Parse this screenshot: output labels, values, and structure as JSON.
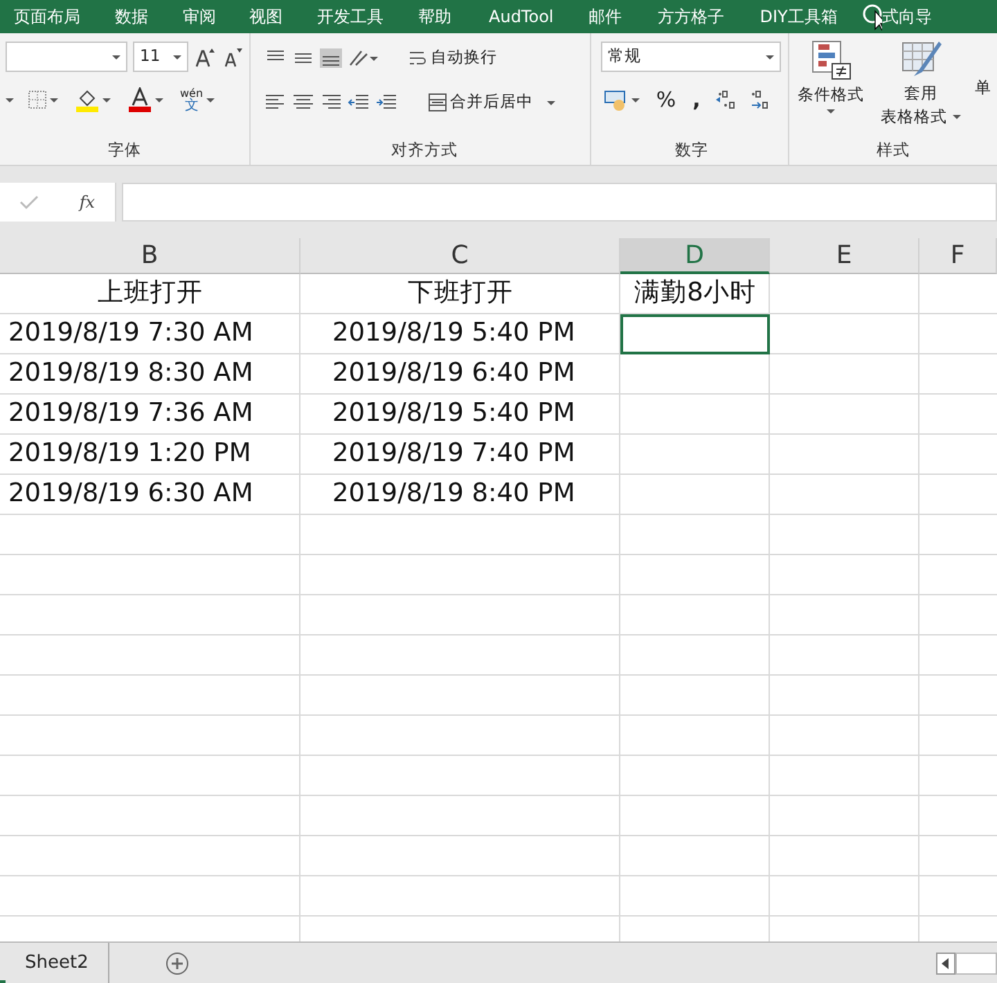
{
  "ribbon_tabs": [
    {
      "label": "页面布局"
    },
    {
      "label": "数据"
    },
    {
      "label": "审阅"
    },
    {
      "label": "视图"
    },
    {
      "label": "开发工具"
    },
    {
      "label": "帮助"
    },
    {
      "label": "AudTool"
    },
    {
      "label": "邮件"
    },
    {
      "label": "方方格子"
    },
    {
      "label": "DIY工具箱"
    },
    {
      "label": "式向导"
    }
  ],
  "ribbon": {
    "font": {
      "size": "11",
      "phonetic_top": "wén",
      "phonetic_bottom": "文",
      "label": "字体"
    },
    "alignment": {
      "wrap": "自动换行",
      "merge": "合并后居中",
      "label": "对齐方式"
    },
    "number": {
      "format": "常规",
      "percent": "%",
      "comma": ",",
      "label": "数字"
    },
    "styles": {
      "conditional": "条件格式",
      "table_top": "套用",
      "table_bottom": "表格格式",
      "cell_cut": "单",
      "label": "样式"
    }
  },
  "formula_bar": {
    "fx": "fx"
  },
  "columns": [
    {
      "label": "B",
      "selected": false
    },
    {
      "label": "C",
      "selected": false
    },
    {
      "label": "D",
      "selected": true
    },
    {
      "label": "E",
      "selected": false
    },
    {
      "label": "F",
      "selected": false
    }
  ],
  "rows": [
    {
      "cells": [
        "上班打开",
        "下班打开",
        "满勤8小时"
      ],
      "selected": false
    },
    {
      "cells": [
        "2019/8/19 7:30 AM",
        "2019/8/19 5:40 PM"
      ],
      "selected": true
    },
    {
      "cells": [
        "2019/8/19 8:30 AM",
        "2019/8/19 6:40 PM"
      ],
      "selected": false
    },
    {
      "cells": [
        "2019/8/19 7:36 AM",
        "2019/8/19 5:40 PM"
      ],
      "selected": false
    },
    {
      "cells": [
        "2019/8/19 1:20 PM",
        "2019/8/19 7:40 PM"
      ],
      "selected": false
    },
    {
      "cells": [
        "2019/8/19 6:30 AM",
        "2019/8/19 8:40 PM"
      ],
      "selected": false
    }
  ],
  "sheet_tabs": [
    {
      "label": "Sheet2",
      "selected": false
    }
  ]
}
